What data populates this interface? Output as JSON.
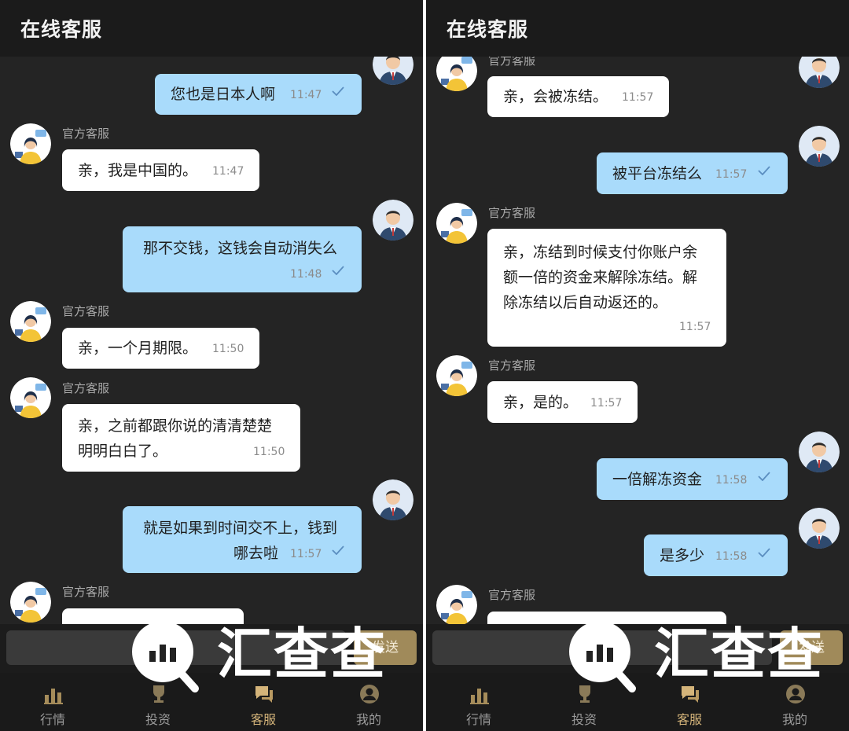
{
  "left": {
    "title": "在线客服",
    "messages": [
      {
        "sender": "",
        "text": "您也是日本人啊",
        "time": "11:47"
      },
      {
        "sender": "官方客服",
        "text": "亲，我是中国的。",
        "time": "11:47"
      },
      {
        "sender": "",
        "text": "那不交钱，这钱会自动消失么",
        "time": "11:48"
      },
      {
        "sender": "官方客服",
        "text": "亲，一个月期限。",
        "time": "11:50"
      },
      {
        "sender": "官方客服",
        "lines": [
          "亲，之前都跟你说的清清楚楚",
          "明明白白了。"
        ],
        "time": "11:50"
      },
      {
        "sender": "",
        "lines": [
          "就是如果到时间交不上，钱到",
          "哪去啦"
        ],
        "time": "11:57"
      },
      {
        "sender": "官方客服"
      }
    ],
    "send_label": "发送"
  },
  "right": {
    "title": "在线客服",
    "messages": [
      {
        "sender": "官方客服",
        "text": "亲，会被冻结。",
        "time": "11:57"
      },
      {
        "sender": "",
        "text": "被平台冻结么",
        "time": "11:57"
      },
      {
        "sender": "官方客服",
        "lines": [
          "亲，冻结到时候支付你账户余",
          "额一倍的资金来解除冻结。解",
          "除冻结以后自动返还的。"
        ],
        "time": "11:57"
      },
      {
        "sender": "官方客服",
        "text": "亲，是的。",
        "time": "11:57"
      },
      {
        "sender": "",
        "text": "一倍解冻资金",
        "time": "11:58"
      },
      {
        "sender": "",
        "text": "是多少",
        "time": "11:58"
      },
      {
        "sender": "官方客服"
      }
    ],
    "send_label": "发送"
  },
  "tabs": [
    {
      "label": "行情",
      "icon": "chart-bars-icon"
    },
    {
      "label": "投资",
      "icon": "trophy-icon"
    },
    {
      "label": "客服",
      "icon": "chat-bubbles-icon",
      "active": true
    },
    {
      "label": "我的",
      "icon": "user-icon"
    }
  ],
  "watermark": {
    "text": "汇查查",
    "icon": "magnifier-bars-icon"
  },
  "colors": {
    "user_bubble": "#a9dbfb",
    "agent_bubble": "#ffffff",
    "background": "#242424",
    "active_tab": "#d4b47a",
    "check": "#5b8ec0"
  }
}
